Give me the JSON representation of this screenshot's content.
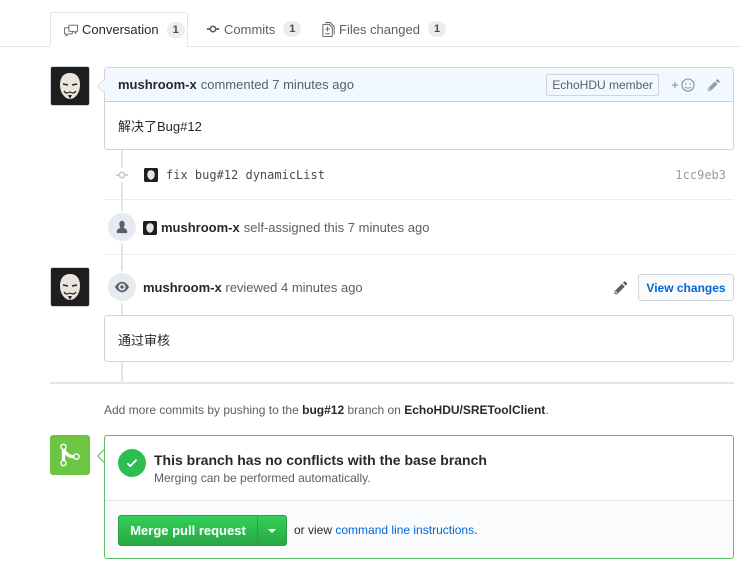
{
  "tabs": [
    {
      "label": "Conversation",
      "count": "1",
      "icon": "comment-discussion-icon"
    },
    {
      "label": "Commits",
      "count": "1",
      "icon": "git-commit-icon"
    },
    {
      "label": "Files changed",
      "count": "1",
      "icon": "file-diff-icon"
    }
  ],
  "comment1": {
    "author": "mushroom-x",
    "action": "commented 7 minutes ago",
    "role": "EchoHDU member",
    "body": "解决了Bug#12"
  },
  "commit": {
    "message": "fix bug#12 dynamicList",
    "sha": "1cc9eb3"
  },
  "assign": {
    "author": "mushroom-x",
    "action": "self-assigned this 7 minutes ago"
  },
  "review": {
    "author": "mushroom-x",
    "action": "reviewed 4 minutes ago",
    "view_changes": "View changes",
    "body": "通过审核"
  },
  "push_hint": {
    "prefix": "Add more commits by pushing to the",
    "branch": "bug#12",
    "middle": "branch on",
    "repo": "EchoHDU/SREToolClient",
    "suffix": "."
  },
  "merge": {
    "title": "This branch has no conflicts with the base branch",
    "subtitle": "Merging can be performed automatically.",
    "button": "Merge pull request",
    "or_view": "or view",
    "cli_link": "command line instructions",
    "cli_suffix": "."
  },
  "colors": {
    "accent": "#0366d6",
    "success": "#28a745",
    "comment_header": "#f1f8ff"
  }
}
